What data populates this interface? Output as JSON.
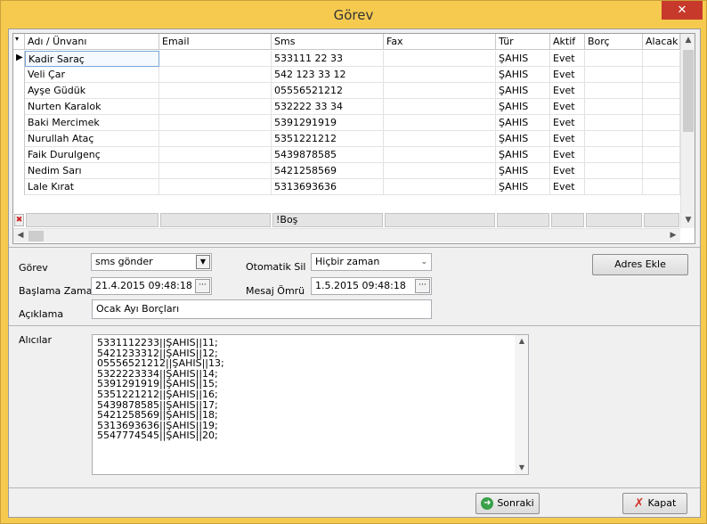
{
  "window": {
    "title": "Görev",
    "close_glyph": "✕"
  },
  "grid": {
    "columns": [
      "Adı / Ünvanı",
      "Email",
      "Sms",
      "Fax",
      "Tür",
      "Aktif",
      "Borç",
      "Alacak"
    ],
    "rows": [
      [
        "Kadir Saraç",
        "",
        "533111 22 33",
        "",
        "ŞAHIS",
        "Evet",
        "",
        ""
      ],
      [
        "Veli Çar",
        "",
        "542 123 33 12",
        "",
        "ŞAHIS",
        "Evet",
        "",
        ""
      ],
      [
        "Ayşe Güdük",
        "",
        "05556521212",
        "",
        "ŞAHIS",
        "Evet",
        "",
        ""
      ],
      [
        "Nurten  Karalok",
        "",
        "532222 33 34",
        "",
        "ŞAHIS",
        "Evet",
        "",
        ""
      ],
      [
        "Baki  Mercimek",
        "",
        "5391291919",
        "",
        "ŞAHIS",
        "Evet",
        "",
        ""
      ],
      [
        "Nurullah Ataç",
        "",
        "5351221212",
        "",
        "ŞAHIS",
        "Evet",
        "",
        ""
      ],
      [
        "Faik Durulgenç",
        "",
        "5439878585",
        "",
        "ŞAHIS",
        "Evet",
        "",
        ""
      ],
      [
        "Nedim  Sarı",
        "",
        "5421258569",
        "",
        "ŞAHIS",
        "Evet",
        "",
        ""
      ],
      [
        "Lale Kırat",
        "",
        "5313693636",
        "",
        "ŞAHIS",
        "Evet",
        "",
        ""
      ]
    ],
    "filter_sms": "!Boş"
  },
  "form": {
    "gorev_label": "Görev",
    "gorev_value": "sms gönder",
    "otomatik_sil_label": "Otomatik Sil",
    "otomatik_sil_value": "Hiçbir zaman",
    "baslama_label": "Başlama Zamanı",
    "baslama_value": "21.4.2015 09:48:18",
    "mesaj_omru_label": "Mesaj Ömrü",
    "mesaj_omru_value": "1.5.2015 09:48:18",
    "aciklama_label": "Açıklama",
    "aciklama_value": "Ocak Ayı Borçları",
    "adres_ekle": "Adres Ekle",
    "alicilar_label": "Alıcılar",
    "alicilar_lines": [
      "5331112233||ŞAHIS||11;",
      "5421233312||ŞAHIS||12;",
      "05556521212||ŞAHIS||13;",
      "5322223334||ŞAHIS||14;",
      "5391291919||ŞAHIS||15;",
      "5351221212||ŞAHIS||16;",
      "5439878585||ŞAHIS||17;",
      "5421258569||ŞAHIS||18;",
      "5313693636||ŞAHIS||19;",
      "5547774545||ŞAHIS||20;"
    ]
  },
  "footer": {
    "sonraki": "Sonraki",
    "kapat": "Kapat"
  }
}
